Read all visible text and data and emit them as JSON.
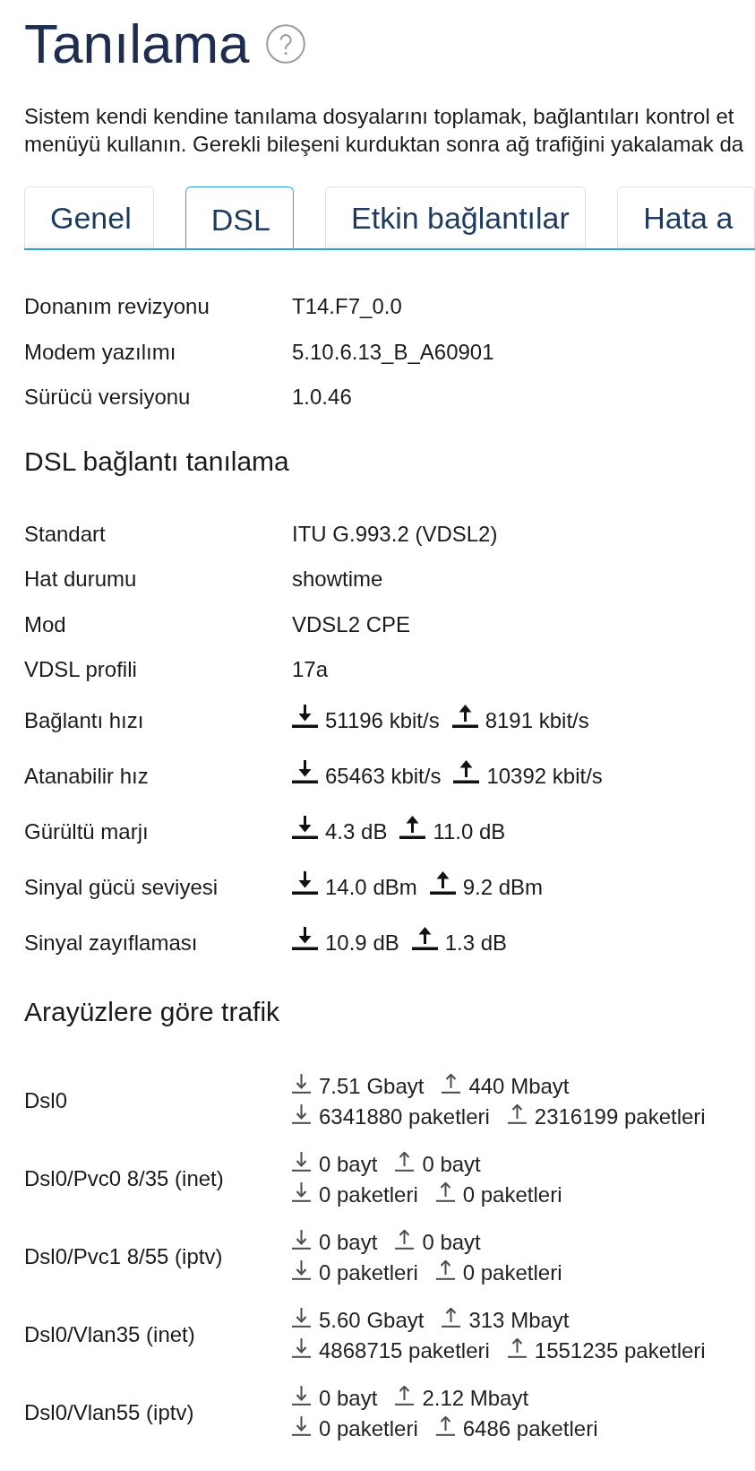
{
  "page": {
    "title": "Tanılama",
    "description": [
      "Sistem kendi kendine tanılama dosyalarını toplamak, bağlantıları kontrol et",
      "menüyü kullanın. Gerekli bileşeni kurduktan sonra ağ trafiğini yakalamak da"
    ]
  },
  "tabs": [
    {
      "label": "Genel",
      "selected": false
    },
    {
      "label": "DSL",
      "selected": true
    },
    {
      "label": "Etkin bağlantılar",
      "selected": false
    },
    {
      "label": "Hata a",
      "selected": false
    }
  ],
  "device_info": [
    {
      "label": "Donanım revizyonu",
      "value": "T14.F7_0.0"
    },
    {
      "label": "Modem yazılımı",
      "value": "5.10.6.13_B_A60901"
    },
    {
      "label": "Sürücü versiyonu",
      "value": "1.0.46"
    }
  ],
  "dsl_diagnostics": {
    "title": "DSL bağlantı tanılama",
    "rows": [
      {
        "kind": "text",
        "label": "Standart",
        "value": "ITU G.993.2 (VDSL2)"
      },
      {
        "kind": "text",
        "label": "Hat durumu",
        "value": "showtime"
      },
      {
        "kind": "text",
        "label": "Mod",
        "value": "VDSL2 CPE"
      },
      {
        "kind": "text",
        "label": "VDSL profili",
        "value": "17a"
      },
      {
        "kind": "updown",
        "label": "Bağlantı hızı",
        "down": "51196 kbit/s",
        "up": "8191 kbit/s"
      },
      {
        "kind": "updown",
        "label": "Atanabilir hız",
        "down": "65463 kbit/s",
        "up": "10392 kbit/s"
      },
      {
        "kind": "updown",
        "label": "Gürültü marjı",
        "down": "4.3 dB",
        "up": "11.0 dB"
      },
      {
        "kind": "updown",
        "label": "Sinyal gücü seviyesi",
        "down": "14.0 dBm",
        "up": "9.2 dBm"
      },
      {
        "kind": "updown",
        "label": "Sinyal zayıflaması",
        "down": "10.9 dB",
        "up": "1.3 dB"
      }
    ]
  },
  "traffic": {
    "title": "Arayüzlere göre trafik",
    "rows": [
      {
        "interface": "Dsl0",
        "bytes_down": "7.51 Gbayt",
        "bytes_up": "440 Mbayt",
        "packets_down": "6341880 paketleri",
        "packets_up": "2316199 paketleri"
      },
      {
        "interface": "Dsl0/Pvc0 8/35 (inet)",
        "bytes_down": "0 bayt",
        "bytes_up": "0 bayt",
        "packets_down": "0 paketleri",
        "packets_up": "0 paketleri"
      },
      {
        "interface": "Dsl0/Pvc1 8/55 (iptv)",
        "bytes_down": "0 bayt",
        "bytes_up": "0 bayt",
        "packets_down": "0 paketleri",
        "packets_up": "0 paketleri"
      },
      {
        "interface": "Dsl0/Vlan35 (inet)",
        "bytes_down": "5.60 Gbayt",
        "bytes_up": "313 Mbayt",
        "packets_down": "4868715 paketleri",
        "packets_up": "1551235 paketleri"
      },
      {
        "interface": "Dsl0/Vlan55 (iptv)",
        "bytes_down": "0 bayt",
        "bytes_up": "2.12 Mbayt",
        "packets_down": "0 paketleri",
        "packets_up": "6486 paketleri"
      }
    ]
  }
}
